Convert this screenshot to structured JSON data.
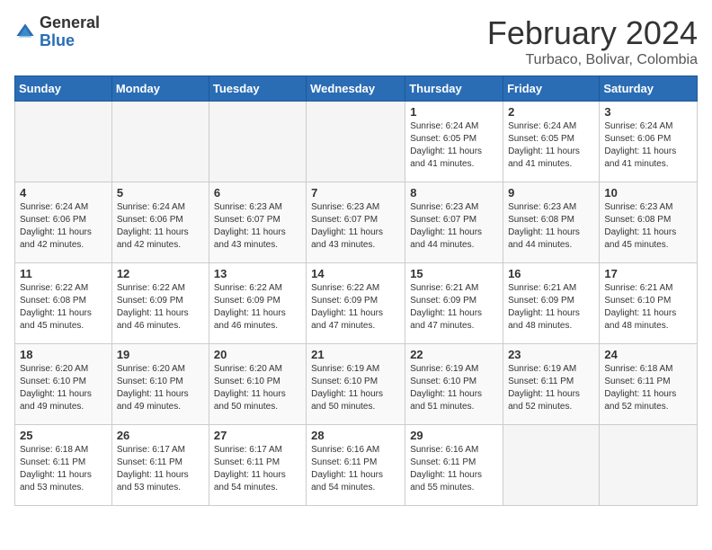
{
  "header": {
    "logo_general": "General",
    "logo_blue": "Blue",
    "title": "February 2024",
    "subtitle": "Turbaco, Bolivar, Colombia"
  },
  "weekdays": [
    "Sunday",
    "Monday",
    "Tuesday",
    "Wednesday",
    "Thursday",
    "Friday",
    "Saturday"
  ],
  "weeks": [
    [
      {
        "day": "",
        "info": ""
      },
      {
        "day": "",
        "info": ""
      },
      {
        "day": "",
        "info": ""
      },
      {
        "day": "",
        "info": ""
      },
      {
        "day": "1",
        "info": "Sunrise: 6:24 AM\nSunset: 6:05 PM\nDaylight: 11 hours and 41 minutes."
      },
      {
        "day": "2",
        "info": "Sunrise: 6:24 AM\nSunset: 6:05 PM\nDaylight: 11 hours and 41 minutes."
      },
      {
        "day": "3",
        "info": "Sunrise: 6:24 AM\nSunset: 6:06 PM\nDaylight: 11 hours and 41 minutes."
      }
    ],
    [
      {
        "day": "4",
        "info": "Sunrise: 6:24 AM\nSunset: 6:06 PM\nDaylight: 11 hours and 42 minutes."
      },
      {
        "day": "5",
        "info": "Sunrise: 6:24 AM\nSunset: 6:06 PM\nDaylight: 11 hours and 42 minutes."
      },
      {
        "day": "6",
        "info": "Sunrise: 6:23 AM\nSunset: 6:07 PM\nDaylight: 11 hours and 43 minutes."
      },
      {
        "day": "7",
        "info": "Sunrise: 6:23 AM\nSunset: 6:07 PM\nDaylight: 11 hours and 43 minutes."
      },
      {
        "day": "8",
        "info": "Sunrise: 6:23 AM\nSunset: 6:07 PM\nDaylight: 11 hours and 44 minutes."
      },
      {
        "day": "9",
        "info": "Sunrise: 6:23 AM\nSunset: 6:08 PM\nDaylight: 11 hours and 44 minutes."
      },
      {
        "day": "10",
        "info": "Sunrise: 6:23 AM\nSunset: 6:08 PM\nDaylight: 11 hours and 45 minutes."
      }
    ],
    [
      {
        "day": "11",
        "info": "Sunrise: 6:22 AM\nSunset: 6:08 PM\nDaylight: 11 hours and 45 minutes."
      },
      {
        "day": "12",
        "info": "Sunrise: 6:22 AM\nSunset: 6:09 PM\nDaylight: 11 hours and 46 minutes."
      },
      {
        "day": "13",
        "info": "Sunrise: 6:22 AM\nSunset: 6:09 PM\nDaylight: 11 hours and 46 minutes."
      },
      {
        "day": "14",
        "info": "Sunrise: 6:22 AM\nSunset: 6:09 PM\nDaylight: 11 hours and 47 minutes."
      },
      {
        "day": "15",
        "info": "Sunrise: 6:21 AM\nSunset: 6:09 PM\nDaylight: 11 hours and 47 minutes."
      },
      {
        "day": "16",
        "info": "Sunrise: 6:21 AM\nSunset: 6:09 PM\nDaylight: 11 hours and 48 minutes."
      },
      {
        "day": "17",
        "info": "Sunrise: 6:21 AM\nSunset: 6:10 PM\nDaylight: 11 hours and 48 minutes."
      }
    ],
    [
      {
        "day": "18",
        "info": "Sunrise: 6:20 AM\nSunset: 6:10 PM\nDaylight: 11 hours and 49 minutes."
      },
      {
        "day": "19",
        "info": "Sunrise: 6:20 AM\nSunset: 6:10 PM\nDaylight: 11 hours and 49 minutes."
      },
      {
        "day": "20",
        "info": "Sunrise: 6:20 AM\nSunset: 6:10 PM\nDaylight: 11 hours and 50 minutes."
      },
      {
        "day": "21",
        "info": "Sunrise: 6:19 AM\nSunset: 6:10 PM\nDaylight: 11 hours and 50 minutes."
      },
      {
        "day": "22",
        "info": "Sunrise: 6:19 AM\nSunset: 6:10 PM\nDaylight: 11 hours and 51 minutes."
      },
      {
        "day": "23",
        "info": "Sunrise: 6:19 AM\nSunset: 6:11 PM\nDaylight: 11 hours and 52 minutes."
      },
      {
        "day": "24",
        "info": "Sunrise: 6:18 AM\nSunset: 6:11 PM\nDaylight: 11 hours and 52 minutes."
      }
    ],
    [
      {
        "day": "25",
        "info": "Sunrise: 6:18 AM\nSunset: 6:11 PM\nDaylight: 11 hours and 53 minutes."
      },
      {
        "day": "26",
        "info": "Sunrise: 6:17 AM\nSunset: 6:11 PM\nDaylight: 11 hours and 53 minutes."
      },
      {
        "day": "27",
        "info": "Sunrise: 6:17 AM\nSunset: 6:11 PM\nDaylight: 11 hours and 54 minutes."
      },
      {
        "day": "28",
        "info": "Sunrise: 6:16 AM\nSunset: 6:11 PM\nDaylight: 11 hours and 54 minutes."
      },
      {
        "day": "29",
        "info": "Sunrise: 6:16 AM\nSunset: 6:11 PM\nDaylight: 11 hours and 55 minutes."
      },
      {
        "day": "",
        "info": ""
      },
      {
        "day": "",
        "info": ""
      }
    ]
  ]
}
